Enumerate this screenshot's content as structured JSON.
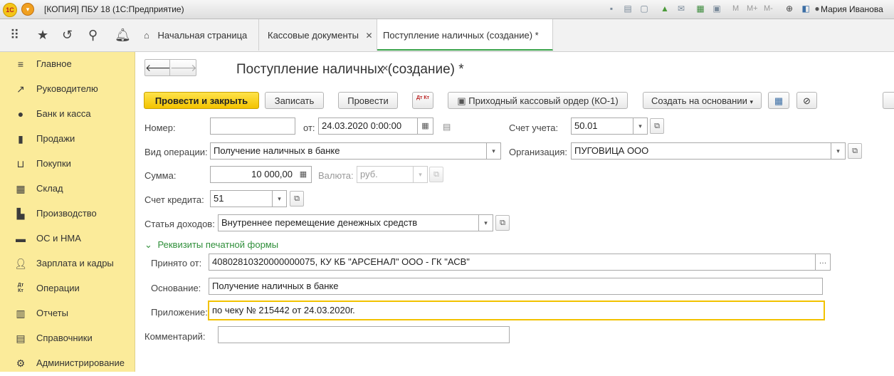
{
  "titlebar": {
    "logo": "1С",
    "title": "[КОПИЯ] ПБУ 18  (1С:Предприятие)",
    "tool_letters": [
      "M",
      "M+",
      "M-"
    ],
    "user": "Мария Иванова"
  },
  "tabs": [
    {
      "label": "Начальная страница",
      "closable": false
    },
    {
      "label": "Кассовые документы",
      "closable": true
    },
    {
      "label": "Поступление наличных (создание) *",
      "closable": true,
      "active": true
    }
  ],
  "sidebar": {
    "items": [
      {
        "label": "Главное",
        "icon": "menu-lines-icon"
      },
      {
        "label": "Руководителю",
        "icon": "trend-chart-icon"
      },
      {
        "label": "Банк и касса",
        "icon": "coin-icon"
      },
      {
        "label": "Продажи",
        "icon": "shopping-bag-icon"
      },
      {
        "label": "Покупки",
        "icon": "cart-icon"
      },
      {
        "label": "Склад",
        "icon": "warehouse-grid-icon"
      },
      {
        "label": "Производство",
        "icon": "factory-icon"
      },
      {
        "label": "ОС и НМА",
        "icon": "truck-icon"
      },
      {
        "label": "Зарплата и кадры",
        "icon": "people-icon"
      },
      {
        "label": "Операции",
        "icon": "dt-kt-icon",
        "icon_text": "Дт Кт"
      },
      {
        "label": "Отчеты",
        "icon": "bar-chart-icon"
      },
      {
        "label": "Справочники",
        "icon": "book-icon"
      },
      {
        "label": "Администрирование",
        "icon": "gear-icon"
      }
    ]
  },
  "form": {
    "title": "Поступление наличных (создание) *",
    "toolbar": {
      "post_close": "Провести и закрыть",
      "save": "Записать",
      "post": "Провести",
      "dtkt": "Дт Кт",
      "print": "Приходный кассовый ордер (КО-1)",
      "create_based": "Создать на основании"
    },
    "fields": {
      "number_label": "Номер:",
      "number_value": "",
      "date_label": "от:",
      "date_value": "24.03.2020  0:00:00",
      "account_label": "Счет учета:",
      "account_value": "50.01",
      "operation_label": "Вид операции:",
      "operation_value": "Получение наличных в банке",
      "org_label": "Организация:",
      "org_value": "ПУГОВИЦА ООО",
      "sum_label": "Сумма:",
      "sum_value": "10 000,00",
      "currency_label": "Валюта:",
      "currency_value": "руб.",
      "credit_label": "Счет кредита:",
      "credit_value": "51",
      "income_label": "Статья доходов:",
      "income_value": "Внутреннее перемещение денежных средств",
      "section_label": "Реквизиты печатной формы",
      "received_label": "Принято от:",
      "received_value": "40802810320000000075, КУ КБ \"АРСЕНАЛ\" ООО - ГК \"АСВ\"",
      "basis_label": "Основание:",
      "basis_value": "Получение наличных в банке",
      "attach_label": "Приложение:",
      "attach_value": "по чеку № 215442 от 24.03.2020г.",
      "comment_label": "Комментарий:",
      "comment_value": ""
    }
  }
}
